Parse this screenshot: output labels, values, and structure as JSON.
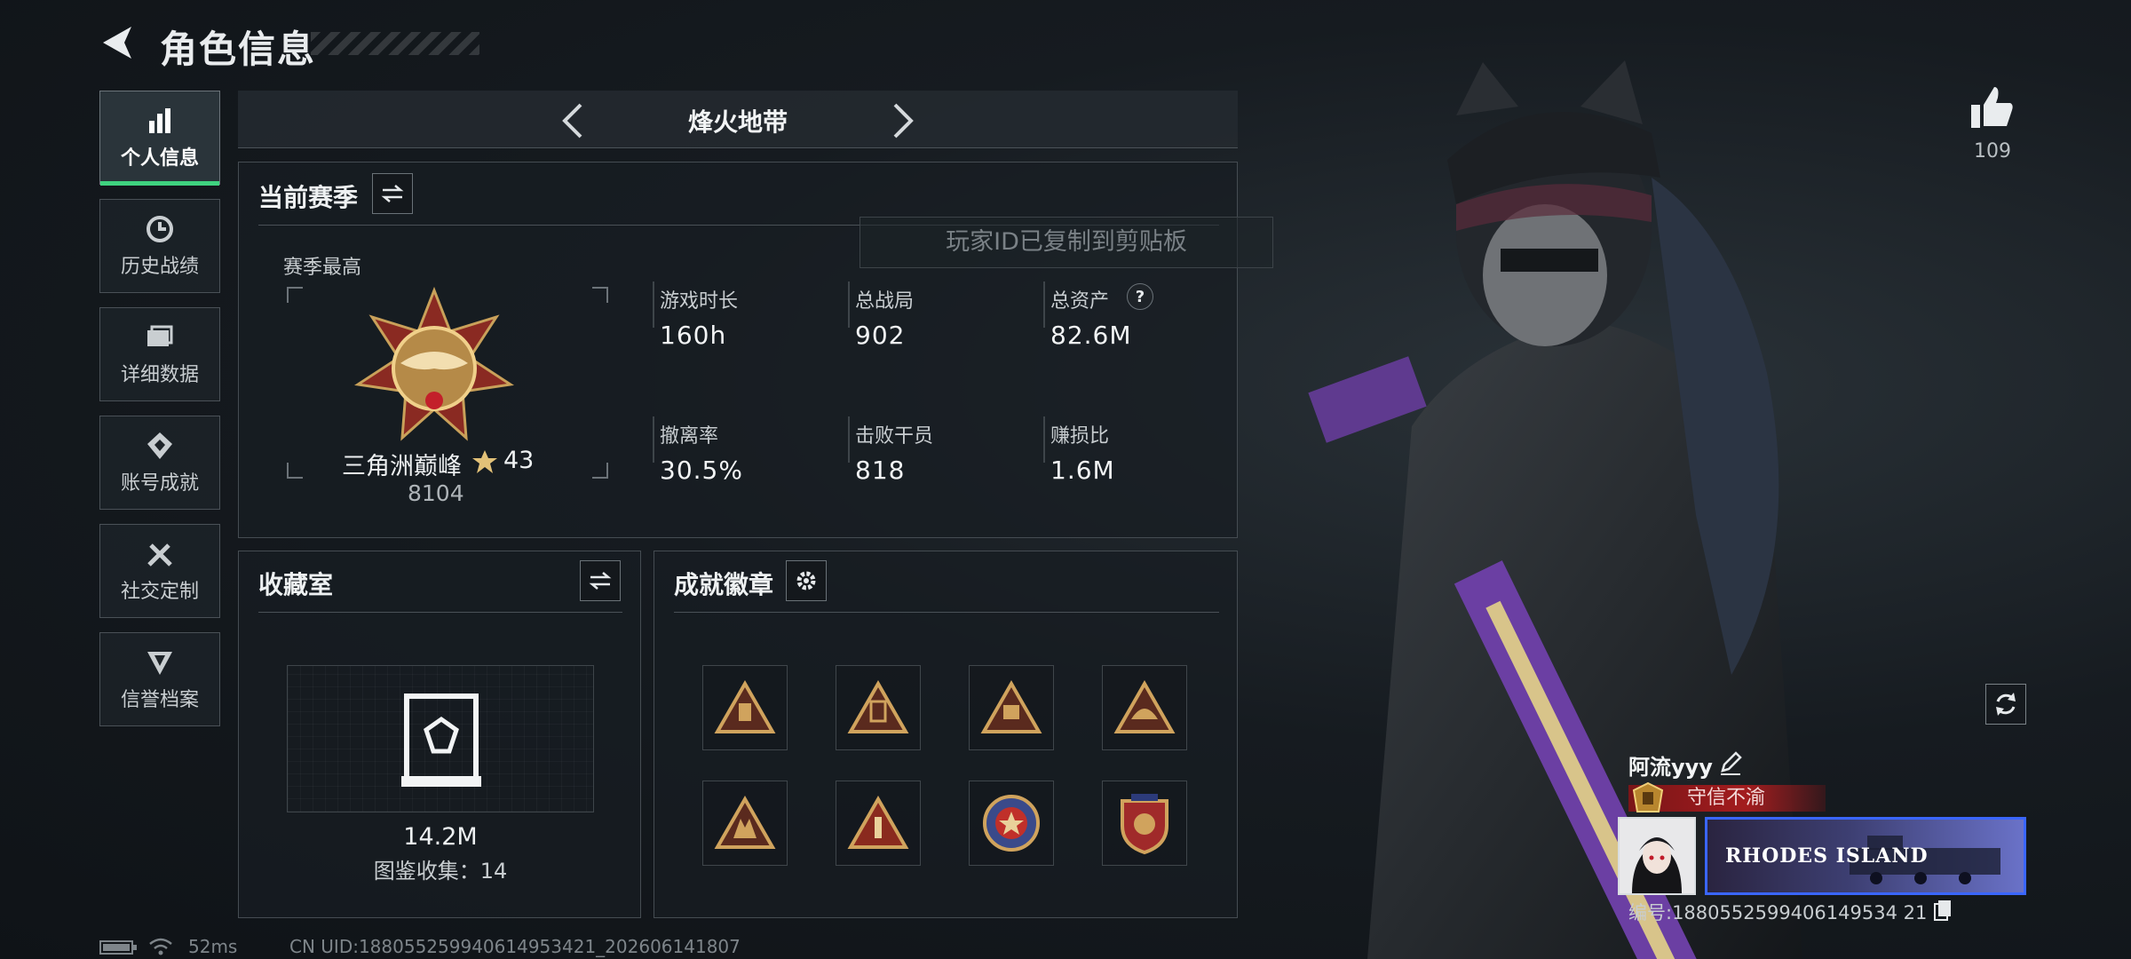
{
  "header": {
    "title": "角色信息"
  },
  "sidebar": {
    "items": [
      {
        "label": "个人信息",
        "icon": "bar-chart-icon",
        "active": true
      },
      {
        "label": "历史战绩",
        "icon": "history-clock-icon"
      },
      {
        "label": "详细数据",
        "icon": "folder-icon"
      },
      {
        "label": "账号成就",
        "icon": "achievement-icon"
      },
      {
        "label": "社交定制",
        "icon": "tools-icon"
      },
      {
        "label": "信誉档案",
        "icon": "shield-icon"
      }
    ]
  },
  "mode": {
    "title": "烽火地带"
  },
  "season": {
    "title": "当前赛季",
    "best_label": "赛季最高",
    "rank_name": "三角洲巅峰",
    "rank_stars": "43",
    "rank_score": "8104",
    "stats": [
      {
        "label": "游戏时长",
        "value": "160h"
      },
      {
        "label": "总战局",
        "value": "902"
      },
      {
        "label": "总资产",
        "value": "82.6M",
        "help": "?"
      },
      {
        "label": "撤离率",
        "value": "30.5%"
      },
      {
        "label": "击败干员",
        "value": "818"
      },
      {
        "label": "赚损比",
        "value": "1.6M"
      }
    ]
  },
  "toast": {
    "text": "玩家ID已复制到剪贴板"
  },
  "collection": {
    "title": "收藏室",
    "value": "14.2M",
    "catalog_label": "图鉴收集：14"
  },
  "achievements": {
    "title": "成就徽章",
    "badges": [
      "badge-1",
      "badge-2",
      "badge-3",
      "badge-4",
      "badge-5",
      "badge-6",
      "badge-7",
      "badge-8"
    ]
  },
  "social": {
    "likes": "109"
  },
  "player": {
    "name": "阿流yyy",
    "honor": "守信不渝",
    "banner_text": "RHODES ISLAND",
    "id_label": "编号:1880552599406149534 21"
  },
  "status": {
    "ping": "52ms",
    "uid": "CN UID:188055259940614953421_202606141807"
  },
  "colors": {
    "accent_green": "#3fd27f",
    "honor_red": "#a31c1e",
    "banner_blue": "#3a66ff",
    "gold": "#c9a15a"
  }
}
